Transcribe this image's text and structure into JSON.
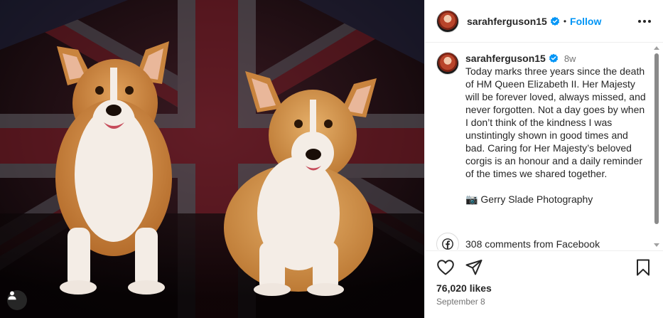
{
  "post": {
    "username": "sarahferguson15",
    "follow_label": "Follow",
    "separator": "•",
    "time_ago": "8w",
    "caption": "Today marks three years since the death of HM Queen Elizabeth II. Her Majesty will be forever loved, always missed, and never forgotten. Not a day goes by when I don’t think of the kindness I was unstintingly shown in good times and bad. Caring for Her Majesty’s beloved corgis is an honour and a daily reminder of the times we shared together.\n\n📷 Gerry Slade Photography",
    "facebook_comments": "308 comments from Facebook",
    "likes": "76,020 likes",
    "date": "September 8"
  },
  "icons": {
    "verified": "verified-badge-icon",
    "more": "more-options-icon",
    "like": "heart-icon",
    "share": "paper-plane-icon",
    "save": "bookmark-icon",
    "facebook": "facebook-icon",
    "tag": "user-tag-icon"
  },
  "colors": {
    "accent": "#0095f6",
    "verified": "#0095f6",
    "text": "#262626",
    "muted": "#737373"
  }
}
